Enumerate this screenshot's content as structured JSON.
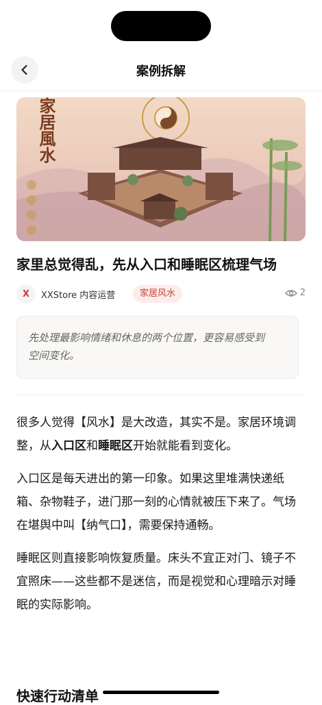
{
  "header": {
    "title": "案例拆解"
  },
  "hero": {
    "vertical_title": "家居風水"
  },
  "article": {
    "title": "家里总觉得乱，先从入口和睡眠区梳理气场",
    "author_initial": "X",
    "author": "XXStore 内容运营",
    "tag": "家居风水",
    "views": "2",
    "summary_line1": "先处理最影响情绪和休息的两个位置，更容易感受到",
    "summary_line2": "空间变化。"
  },
  "body": {
    "p1_a": "很多人觉得【风水】是大改造，其实不是。家居环境调整，从",
    "p1_b": "入口区",
    "p1_c": "和",
    "p1_d": "睡眠区",
    "p1_e": "开始就能看到变化。",
    "p2": "入口区是每天进出的第一印象。如果这里堆满快递纸箱、杂物鞋子，进门那一刻的心情就被压下来了。气场在堪舆中叫【纳气口】，需要保持通畅。",
    "p3": "睡眠区则直接影响恢复质量。床头不宜正对门、镜子不宜照床——这些都不是迷信，而是视觉和心理暗示对睡眠的实际影响。",
    "section": "快速行动清单"
  },
  "colors": {
    "accent": "#c8412e",
    "tag_bg": "#fdecec"
  }
}
